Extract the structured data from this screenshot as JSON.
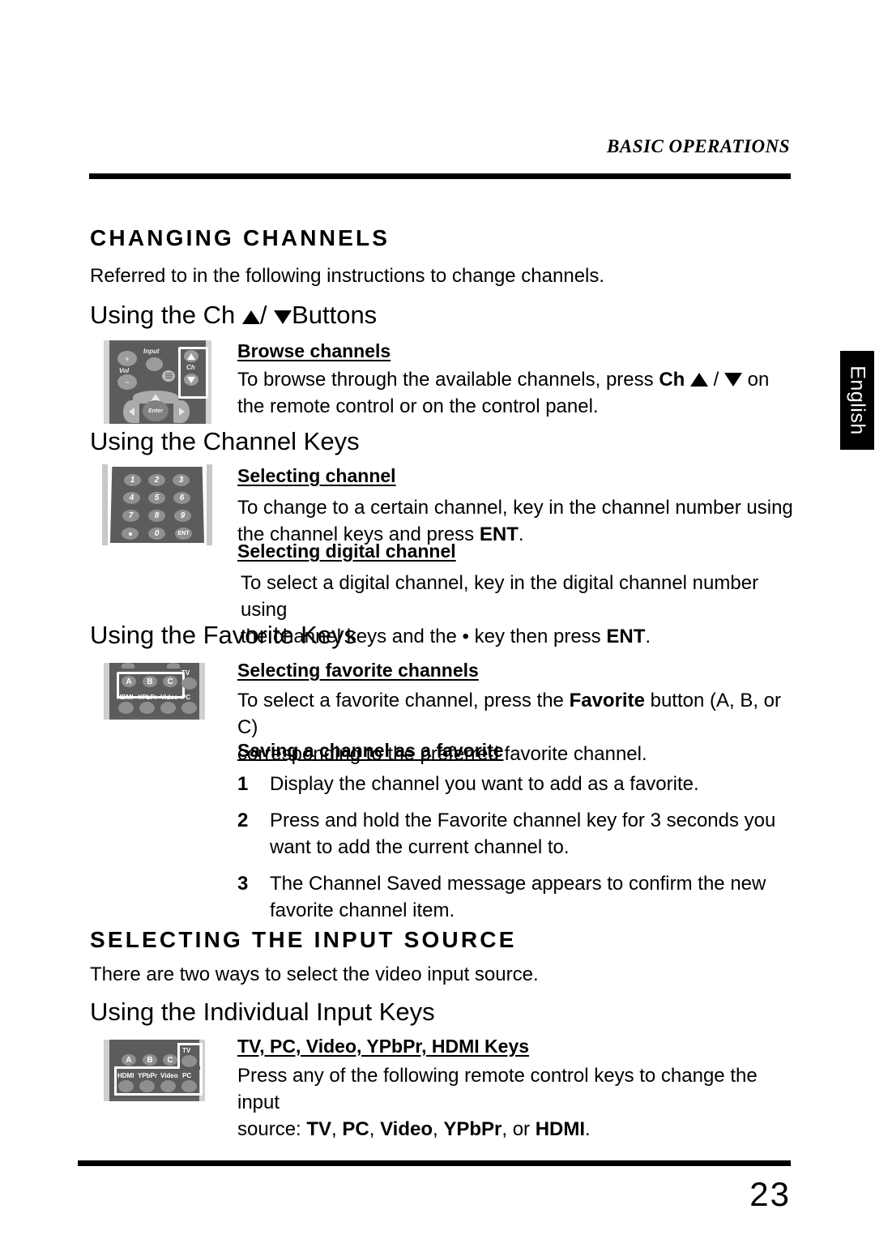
{
  "page": {
    "running_head": "BASIC OPERATIONS",
    "page_number": "23",
    "side_tab": "English"
  },
  "sections": [
    {
      "heading": "CHANGING CHANNELS",
      "intro": "Referred to in the following instructions to change channels."
    },
    {
      "heading": "SELECTING THE INPUT SOURCE",
      "intro": "There are two ways to select the video input source."
    }
  ],
  "subsections": {
    "ch_buttons": {
      "title_prefix": "Using the Ch ",
      "title_suffix": "Buttons",
      "subhead": "Browse channels",
      "body_1": "To browse through the available channels, press ",
      "body_ch": "Ch",
      "body_2": " on",
      "body_3": "the remote control or on the control panel."
    },
    "channel_keys": {
      "title": "Using the Channel Keys",
      "subhead_1": "Selecting channel",
      "body_1a": "To change to a certain channel, key in the channel number using",
      "body_1b": "the channel keys and press ",
      "body_1c": "ENT",
      "body_1d": ".",
      "subhead_2": "Selecting digital channel",
      "body_2a": "To select a digital channel, key in the digital channel number using",
      "body_2b": "the channel keys and the • key then press ",
      "body_2c": "ENT",
      "body_2d": "."
    },
    "favorite_keys": {
      "title": "Using the Favorite Keys",
      "subhead_1": "Selecting favorite channels ",
      "body_1a": "To select a favorite channel, press the ",
      "body_1b": "Favorite",
      "body_1c": " button (A, B, or C)",
      "body_1d": "corresponding to the preferred favorite channel.",
      "subhead_2": "Saving a channel as a favorite",
      "steps": [
        {
          "num": "1",
          "text": "Display the channel you want to add as a favorite."
        },
        {
          "num": "2",
          "text": "Press and hold the Favorite channel key for 3 seconds you want to add the current channel to."
        },
        {
          "num": "3",
          "text": "The Channel Saved message appears to confirm the new favorite channel item."
        }
      ]
    },
    "input_keys": {
      "title": "Using the Individual Input Keys",
      "subhead": "TV, PC, Video, YPbPr, HDMI Keys",
      "body_a": "Press any of the following remote control keys to change the input",
      "body_b": "source: ",
      "k_tv": "TV",
      "sep1": ", ",
      "k_pc": "PC",
      "sep2": ", ",
      "k_video": "Video",
      "sep3": ", ",
      "k_ypbpr": "YPbPr",
      "sep4": ", or ",
      "k_hdmi": "HDMI",
      "end": "."
    }
  },
  "artwork": {
    "ch_remote": {
      "label_input": "Input",
      "label_vol": "Vol",
      "label_ch": "Ch",
      "btn_plus": "+",
      "btn_minus": "−",
      "btn_enter": "Enter"
    },
    "keypad": {
      "keys": [
        "1",
        "2",
        "3",
        "4",
        "5",
        "6",
        "7",
        "8",
        "9",
        "•",
        "0",
        "ENT"
      ]
    },
    "fav_remote": {
      "favorites": [
        "A",
        "B",
        "C"
      ],
      "label_tv": "TV",
      "label_pc": "PC",
      "label_hdmi": "HDMI",
      "label_ypbpr": "YPbPr",
      "label_video": "Video"
    }
  }
}
